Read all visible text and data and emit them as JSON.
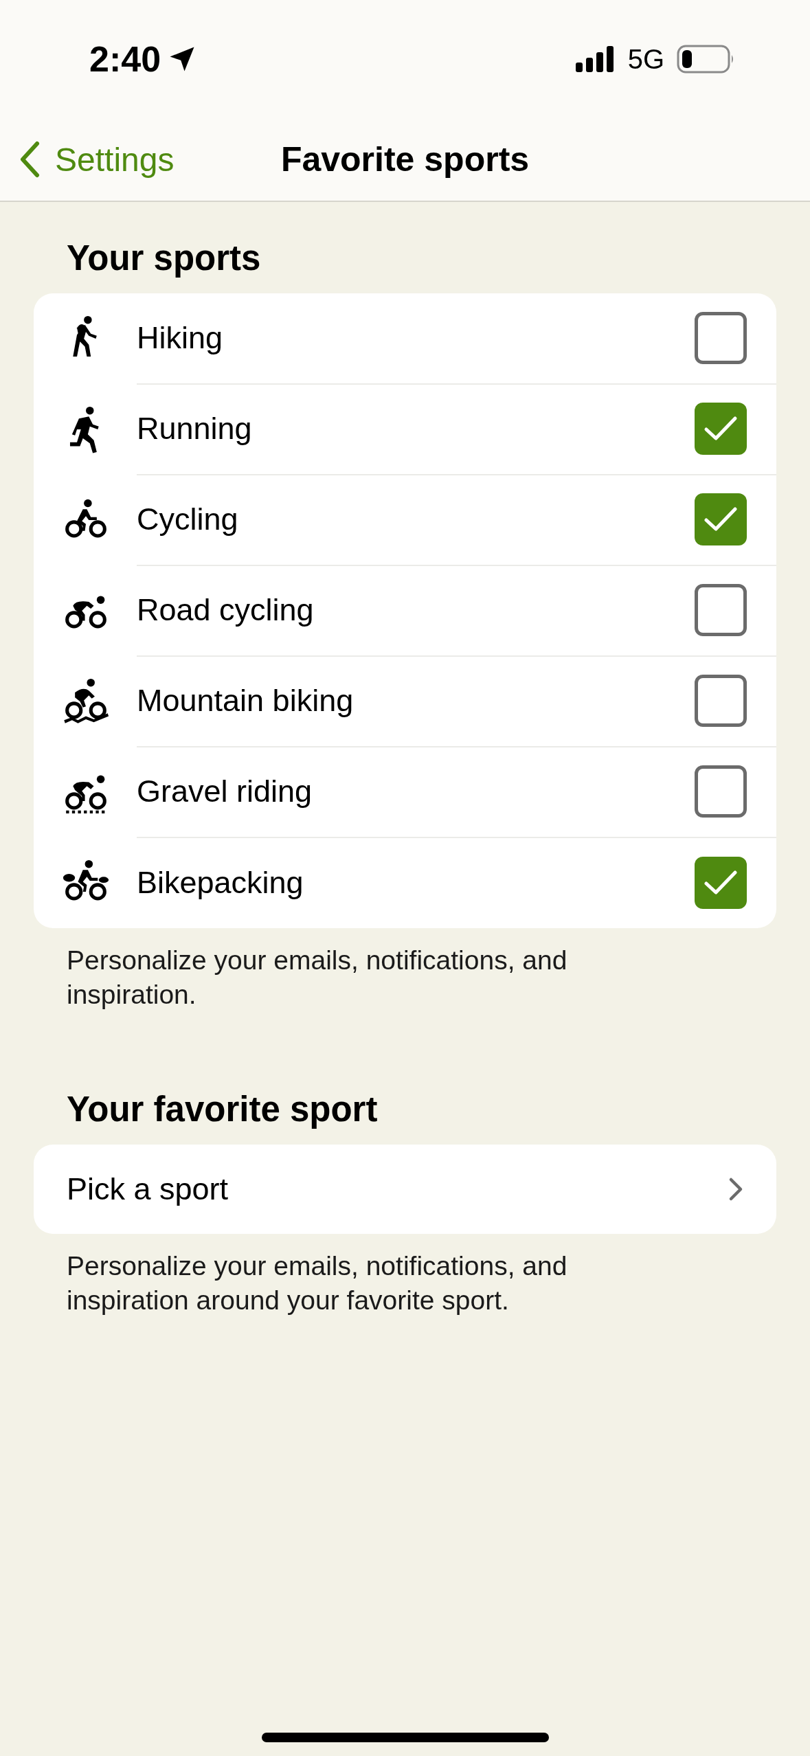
{
  "status_bar": {
    "time": "2:40",
    "network": "5G"
  },
  "nav": {
    "back": "Settings",
    "title": "Favorite sports"
  },
  "sports_section": {
    "header": "Your sports",
    "items": [
      {
        "label": "Hiking",
        "checked": false
      },
      {
        "label": "Running",
        "checked": true
      },
      {
        "label": "Cycling",
        "checked": true
      },
      {
        "label": "Road cycling",
        "checked": false
      },
      {
        "label": "Mountain biking",
        "checked": false
      },
      {
        "label": "Gravel riding",
        "checked": false
      },
      {
        "label": "Bikepacking",
        "checked": true
      }
    ],
    "footer": "Personalize your emails, notifications, and inspiration."
  },
  "favorite_section": {
    "header": "Your favorite sport",
    "picker": "Pick a sport",
    "footer": "Personalize your emails, notifications, and inspiration around your favorite sport."
  }
}
